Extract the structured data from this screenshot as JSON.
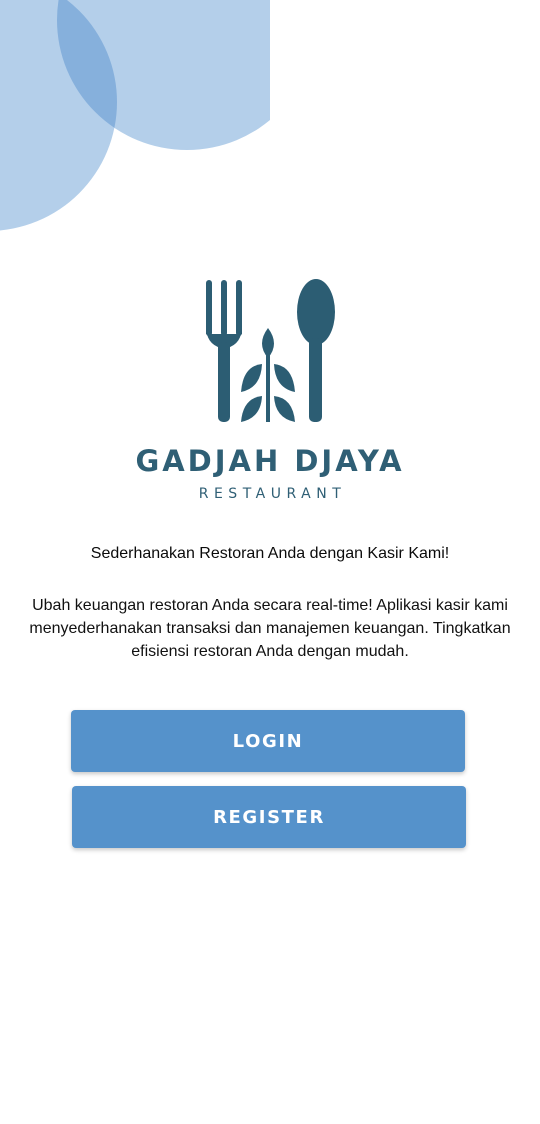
{
  "brand": {
    "name": "GADJAH DJAYA",
    "subtitle": "RESTAURANT",
    "logo_icon": "fork-spoon-leaf-icon",
    "logo_color": "#2c5d73"
  },
  "hero": {
    "headline": "Sederhanakan Restoran Anda dengan Kasir Kami!",
    "description": "Ubah keuangan restoran Anda secara real-time! Aplikasi kasir kami menyederhanakan transaksi dan manajemen keuangan. Tingkatkan efisiensi restoran Anda dengan mudah."
  },
  "actions": {
    "login_label": "LOGIN",
    "register_label": "REGISTER"
  },
  "colors": {
    "primary_button": "#5592cb",
    "decor_light": "#b4cfea",
    "decor_overlap": "#86b0dc"
  }
}
